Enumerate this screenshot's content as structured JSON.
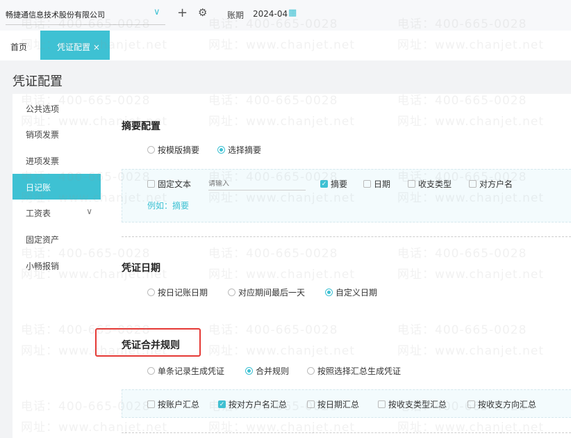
{
  "topbar": {
    "company": "畅捷通信息技术股份有限公司",
    "period_label": "账期",
    "period": "2024-04"
  },
  "tabs": {
    "home": "首页",
    "active": "凭证配置",
    "close": "×"
  },
  "page_title": "凭证配置",
  "sidebar": {
    "items": [
      {
        "label": "公共选项"
      },
      {
        "label": "销项发票"
      },
      {
        "label": "进项发票"
      },
      {
        "label": "日记账"
      },
      {
        "label": "工资表"
      },
      {
        "label": "固定资产"
      },
      {
        "label": "小畅报销"
      }
    ]
  },
  "summary": {
    "title": "摘要配置",
    "radios": [
      "按模版摘要",
      "选择摘要"
    ],
    "fixed_text": "固定文本",
    "placeholder": "请输入",
    "checks": [
      "摘要",
      "日期",
      "收支类型",
      "对方户名"
    ],
    "example": "例如：摘要"
  },
  "date": {
    "title": "凭证日期",
    "radios": [
      "按日记账日期",
      "对应期间最后一天",
      "自定义日期"
    ]
  },
  "merge": {
    "title": "凭证合并规则",
    "radios": [
      "单条记录生成凭证",
      "合并规则",
      "按照选择汇总生成凭证"
    ],
    "checks": [
      "按账户汇总",
      "按对方户名汇总",
      "按日期汇总",
      "按收支类型汇总",
      "按收支方向汇总"
    ]
  },
  "watermark": {
    "phone": "电话：400-665-0028",
    "site": "网址：www.chanjet.net"
  },
  "colors": {
    "accent": "#3ec1d3",
    "highlight": "#e53935"
  }
}
